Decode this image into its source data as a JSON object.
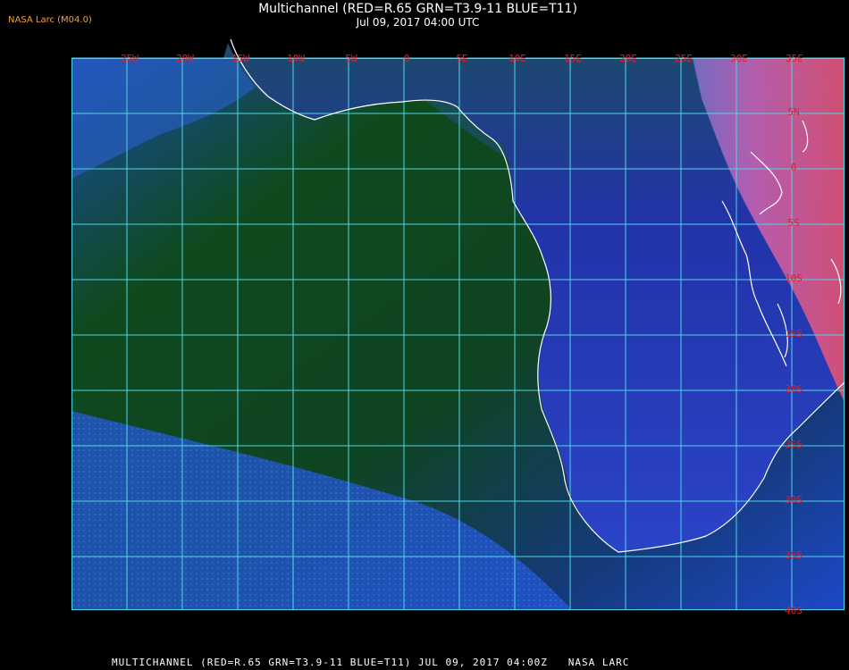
{
  "brand": "NASA Larc (M04.0)",
  "title": {
    "line1": "Multichannel (RED=R.65 GRN=T3.9-11 BLUE=T11)",
    "line2": "Jul 09, 2017 04:00 UTC"
  },
  "footer": "MULTICHANNEL (RED=R.65 GRN=T3.9-11 BLUE=T11) JUL 09, 2017 04:00Z   NASA LARC",
  "map": {
    "lon_labels": [
      "25W",
      "20W",
      "15W",
      "10W",
      "5W",
      "0",
      "5E",
      "10E",
      "15E",
      "20E",
      "25E",
      "30E",
      "35E"
    ],
    "lat_labels": [
      "5N",
      "0",
      "5S",
      "10S",
      "15S",
      "20S",
      "25S",
      "30S",
      "35S",
      "40S"
    ],
    "colors": {
      "grid": "#4fd6e6",
      "label": "#e0202a",
      "coast": "#ffffff",
      "ocean_green": "#0f4a1e",
      "ocean_blue": "#1d48c8",
      "land_blue": "#2436b4",
      "land_magenta": "#c85aa8"
    }
  }
}
